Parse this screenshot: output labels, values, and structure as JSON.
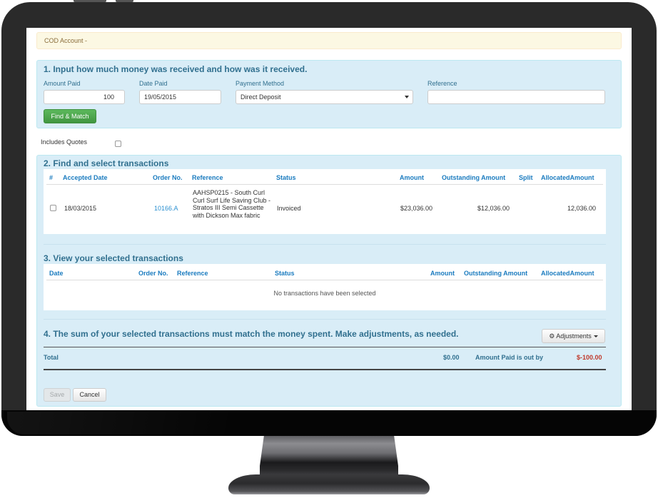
{
  "alert": {
    "text": "COD Account -"
  },
  "step1": {
    "title": "1. Input how much money was received and how was it received.",
    "amount_paid": {
      "label": "Amount Paid",
      "value": "100"
    },
    "date_paid": {
      "label": "Date Paid",
      "value": "19/05/2015"
    },
    "payment_method": {
      "label": "Payment Method",
      "selected": "Direct Deposit"
    },
    "reference": {
      "label": "Reference",
      "value": ""
    },
    "find_match_label": "Find & Match"
  },
  "includes_quotes": {
    "label": "Includes Quotes",
    "checked": false
  },
  "step2": {
    "title": "2. Find and select transactions",
    "columns": [
      "#",
      "Accepted Date",
      "Order No.",
      "Reference",
      "Status",
      "Amount",
      "Outstanding Amount",
      "Split",
      "AllocatedAmount"
    ],
    "rows": [
      {
        "checked": false,
        "accepted_date": "18/03/2015",
        "order_no": "10166.A",
        "reference": "AAHSP0215 - South Curl Curl Surf Life Saving Club - Stratos III Semi Cassette with Dickson Max fabric",
        "status": "Invoiced",
        "amount": "$23,036.00",
        "outstanding_amount": "$12,036.00",
        "split": "",
        "allocated_amount": "12,036.00"
      }
    ]
  },
  "step3": {
    "title": "3. View your selected transactions",
    "columns": [
      "Date",
      "Order No.",
      "Reference",
      "Status",
      "Amount",
      "Outstanding Amount",
      "AllocatedAmount"
    ],
    "empty_message": "No transactions have been selected"
  },
  "step4": {
    "title": "4. The sum of your selected transactions must match the money spent. Make adjustments, as needed.",
    "adjustments_label": "Adjustments",
    "total_label": "Total",
    "total_value": "$0.00",
    "out_by_label": "Amount Paid is out by",
    "out_by_value": "$-100.00"
  },
  "actions": {
    "save_label": "Save",
    "cancel_label": "Cancel"
  },
  "colors": {
    "heading": "#31708f",
    "link": "#1a7bbf",
    "negative": "#c0392b",
    "success": "#5cb85c",
    "panel_bg": "#d9edf7",
    "alert_bg": "#fcf8e3"
  }
}
